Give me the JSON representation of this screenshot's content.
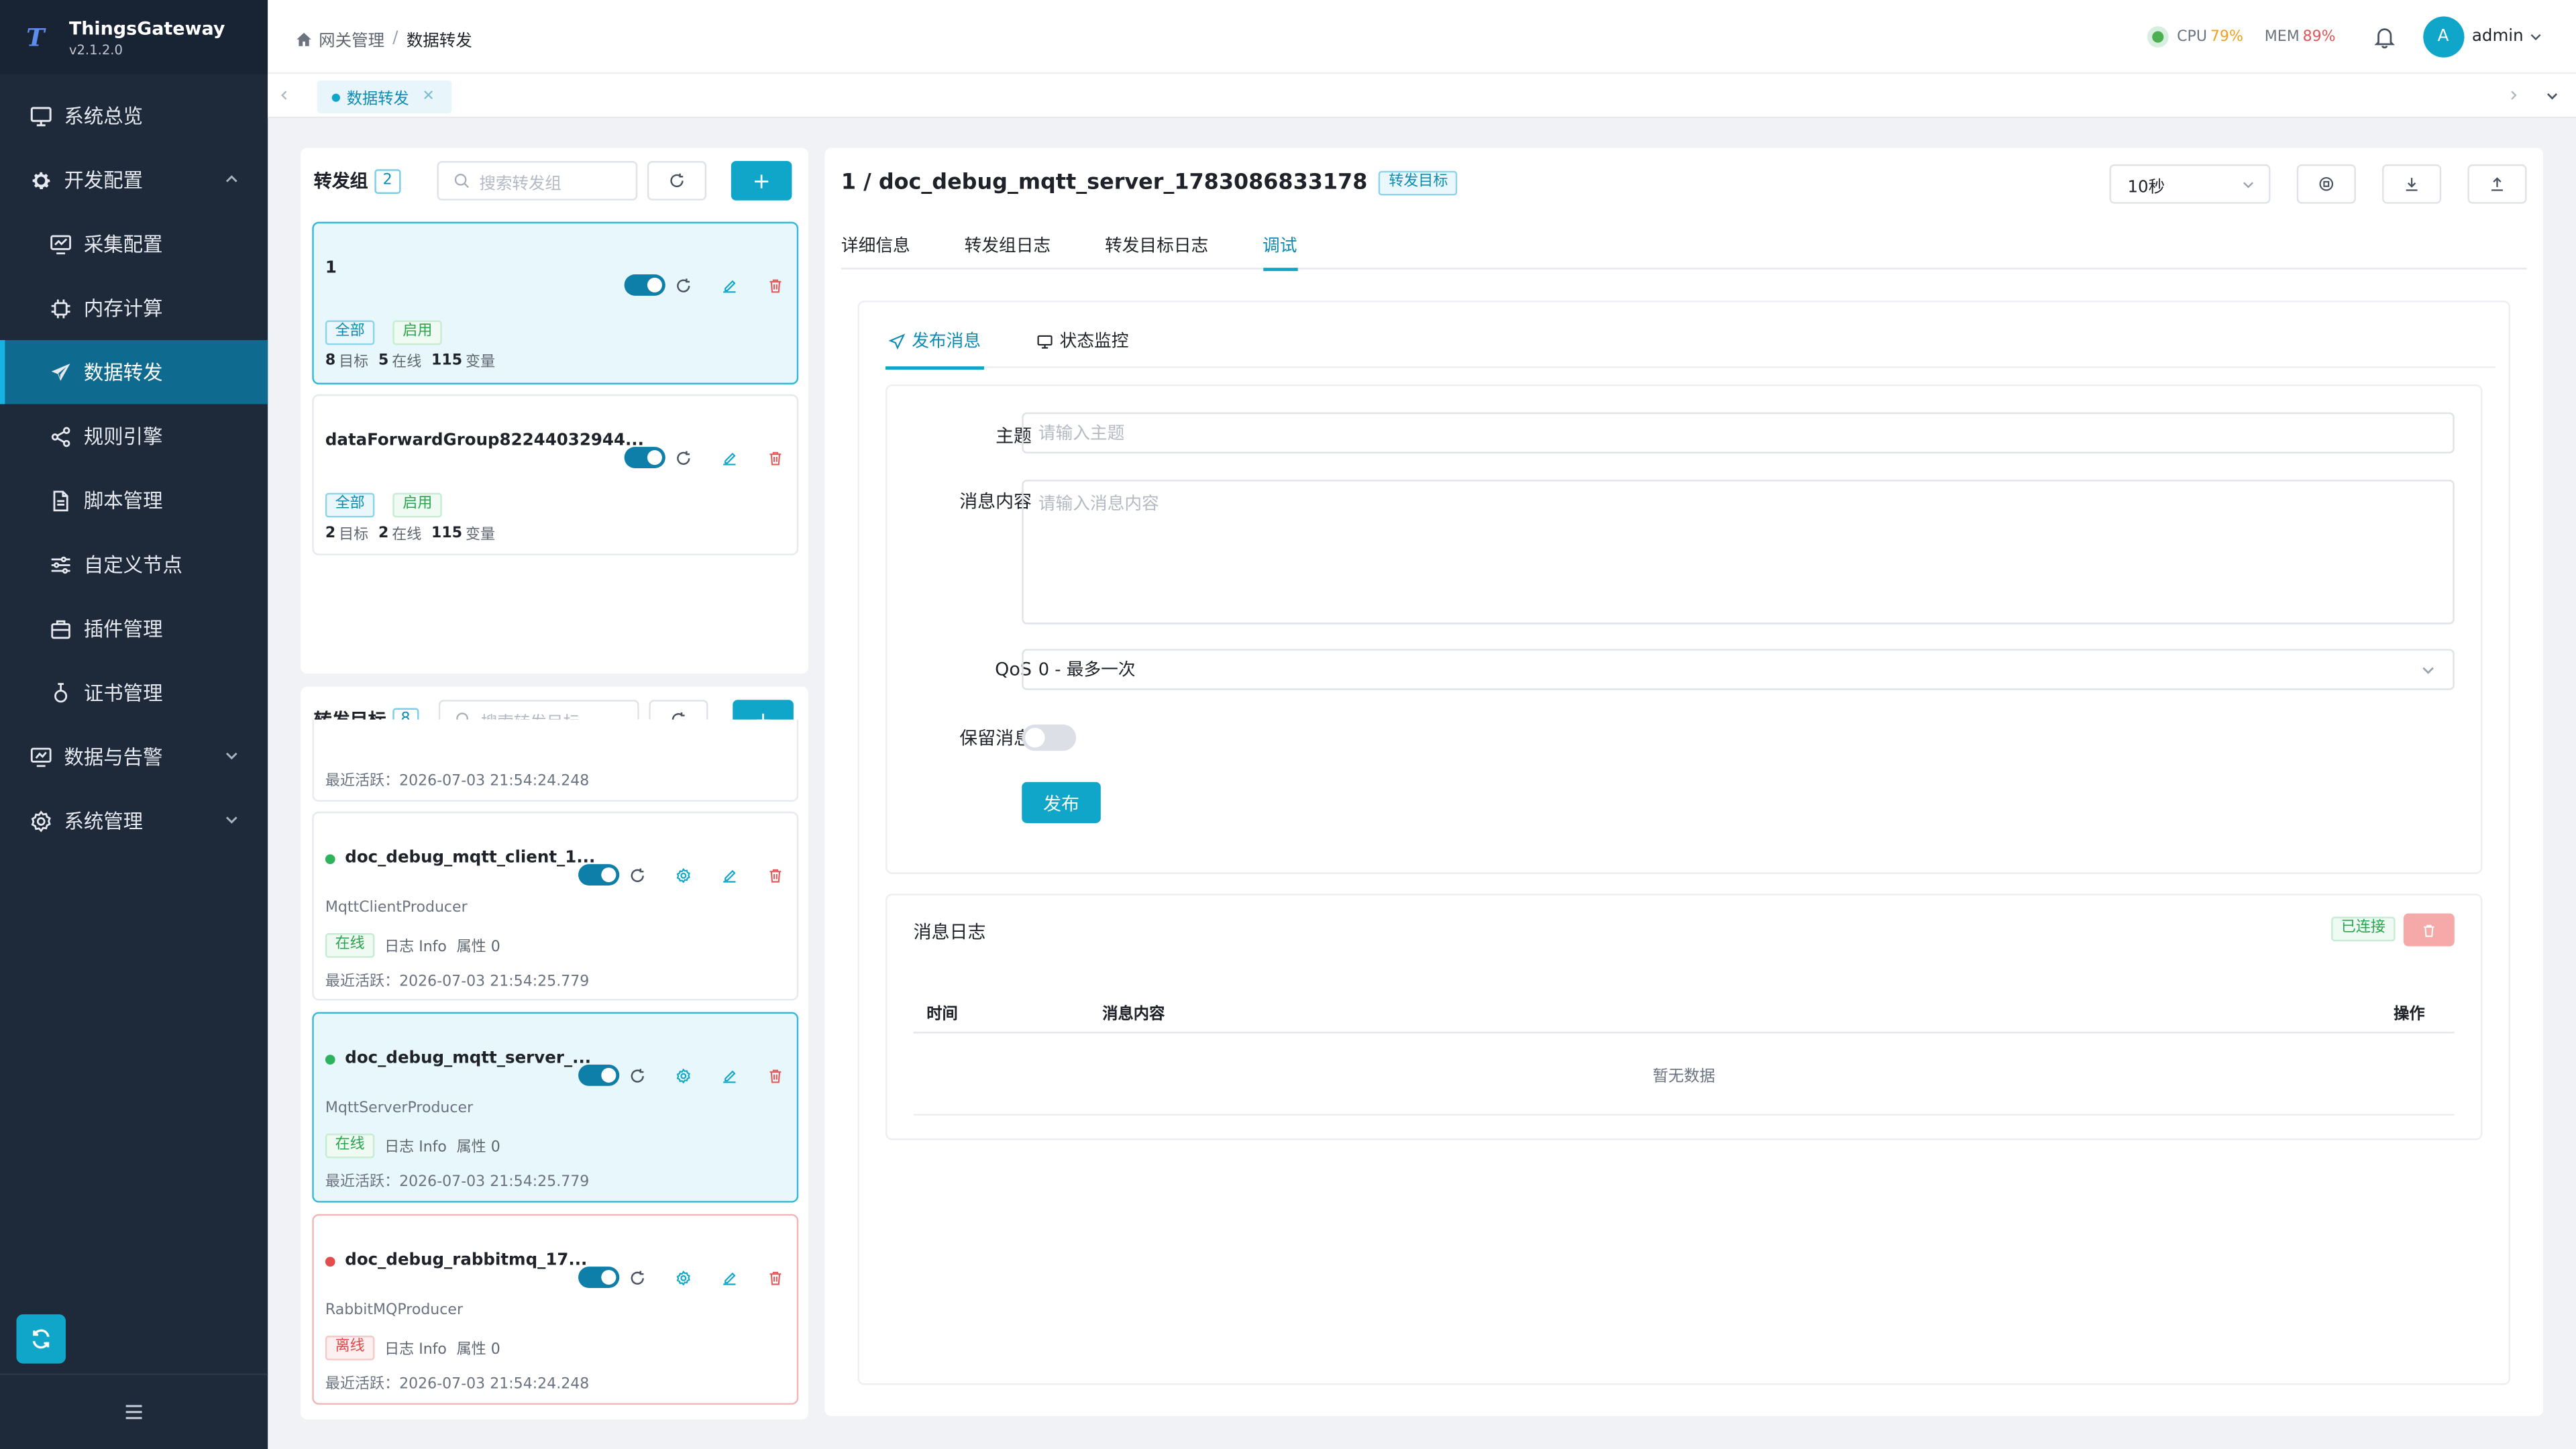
{
  "app": {
    "name": "ThingsGateway",
    "version": "v2.1.2.0"
  },
  "sidebar": {
    "items": [
      {
        "label": "系统总览",
        "icon": "monitor-icon",
        "level": "top"
      },
      {
        "label": "开发配置",
        "icon": "gear-icon",
        "level": "top",
        "expanded": true
      },
      {
        "label": "采集配置",
        "icon": "collect-icon",
        "level": "sub"
      },
      {
        "label": "内存计算",
        "icon": "chip-icon",
        "level": "sub"
      },
      {
        "label": "数据转发",
        "icon": "send-icon",
        "level": "sub",
        "active": true
      },
      {
        "label": "规则引擎",
        "icon": "share-icon",
        "level": "sub"
      },
      {
        "label": "脚本管理",
        "icon": "file-icon",
        "level": "sub"
      },
      {
        "label": "自定义节点",
        "icon": "sliders-icon",
        "level": "sub"
      },
      {
        "label": "插件管理",
        "icon": "plugin-icon",
        "level": "sub"
      },
      {
        "label": "证书管理",
        "icon": "certificate-icon",
        "level": "sub"
      },
      {
        "label": "数据与告警",
        "icon": "dashboard-icon",
        "level": "top"
      },
      {
        "label": "系统管理",
        "icon": "settings-icon",
        "level": "top"
      }
    ]
  },
  "header": {
    "breadcrumb": [
      "网关管理",
      "数据转发"
    ],
    "cpu_label": "CPU",
    "cpu_value": "79%",
    "mem_label": "MEM",
    "mem_value": "89%",
    "avatar_letter": "A",
    "user": "admin"
  },
  "tabstrip": {
    "tab": "数据转发"
  },
  "groups": {
    "title": "转发组",
    "count": "2",
    "search_placeholder": "搜索转发组",
    "items": [
      {
        "name": "1",
        "tag_scope": "全部",
        "tag_state": "启用",
        "targets": "8",
        "online": "5",
        "vars": "115",
        "selected": true
      },
      {
        "name": "dataForwardGroup82244032944...",
        "tag_scope": "全部",
        "tag_state": "启用",
        "targets": "2",
        "online": "2",
        "vars": "115",
        "selected": false
      }
    ],
    "targets_label": "目标",
    "online_label": "在线",
    "vars_label": "变量"
  },
  "targets": {
    "title": "转发目标",
    "count": "8",
    "search_placeholder": "搜索转发目标",
    "partial_last_active": "最近活跃：2026-07-03 21:54:24.248",
    "items": [
      {
        "name": "doc_debug_mqtt_client_1...",
        "type": "MqttClientProducer",
        "status": "在线",
        "status_kind": "online",
        "log": "日志 Info",
        "attrs": "属性 0",
        "last": "最近活跃：2026-07-03 21:54:25.779"
      },
      {
        "name": "doc_debug_mqtt_server_...",
        "type": "MqttServerProducer",
        "status": "在线",
        "status_kind": "online",
        "log": "日志 Info",
        "attrs": "属性 0",
        "last": "最近活跃：2026-07-03 21:54:25.779"
      },
      {
        "name": "doc_debug_rabbitmq_17...",
        "type": "RabbitMQProducer",
        "status": "离线",
        "status_kind": "offline",
        "log": "日志 Info",
        "attrs": "属性 0",
        "last": "最近活跃：2026-07-03 21:54:24.248"
      }
    ]
  },
  "main": {
    "title": "1 / doc_debug_mqtt_server_1783086833178",
    "title_tag": "转发目标",
    "interval": "10秒",
    "tabs": [
      "详细信息",
      "转发组日志",
      "转发目标日志",
      "调试"
    ],
    "active_tab": 3,
    "sub_tabs": [
      "发布消息",
      "状态监控"
    ],
    "form": {
      "topic_label": "主题",
      "topic_placeholder": "请输入主题",
      "content_label": "消息内容",
      "content_placeholder": "请输入消息内容",
      "qos_label": "QoS",
      "qos_value": "0 - 最多一次",
      "retain_label": "保留消息",
      "retain_on": false,
      "publish_label": "发布"
    },
    "log": {
      "title": "消息日志",
      "status": "已连接",
      "columns": [
        "时间",
        "消息内容",
        "操作"
      ],
      "empty": "暂无数据"
    }
  }
}
